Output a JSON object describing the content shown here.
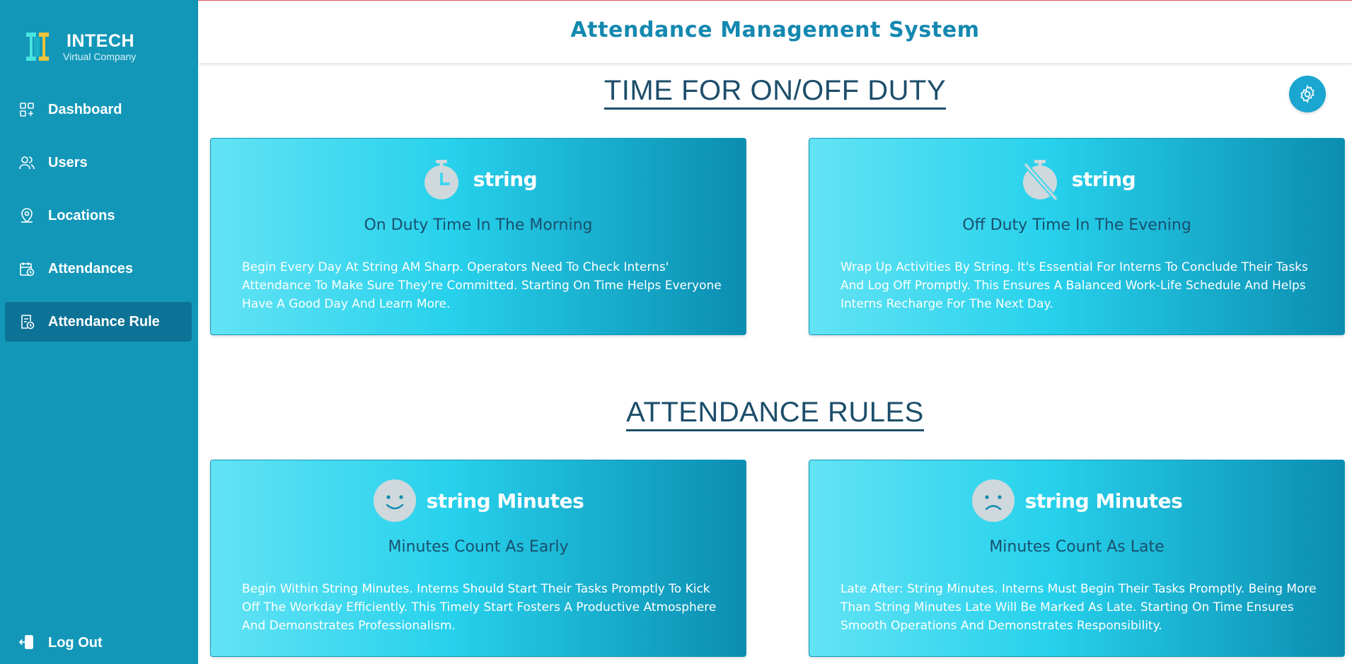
{
  "brand": {
    "name": "INTECH",
    "tagline": "Virtual Company"
  },
  "sidebar": {
    "items": [
      {
        "label": "Dashboard",
        "icon": "dashboard-icon"
      },
      {
        "label": "Users",
        "icon": "users-icon"
      },
      {
        "label": "Locations",
        "icon": "location-icon"
      },
      {
        "label": "Attendances",
        "icon": "calendar-clock-icon"
      },
      {
        "label": "Attendance Rule",
        "icon": "rule-icon",
        "active": true
      }
    ],
    "logout": {
      "label": "Log Out",
      "icon": "logout-icon"
    }
  },
  "header": {
    "title": "Attendance Management System"
  },
  "sections": {
    "duty_title": "TIME FOR ON/OFF DUTY",
    "rules_title": "ATTENDANCE RULES"
  },
  "settings": {
    "icon": "settings-gear-icon"
  },
  "cards": {
    "on_duty": {
      "icon": "stopwatch-icon",
      "value": "string",
      "subtitle": "On Duty Time In The Morning",
      "description": "Begin Every Day At String AM Sharp. Operators Need To Check Interns' Attendance To Make Sure They're Committed. Starting On Time Helps Everyone Have A Good Day And Learn More."
    },
    "off_duty": {
      "icon": "stopwatch-off-icon",
      "value": "string",
      "subtitle": "Off Duty Time In The Evening",
      "description": "Wrap Up Activities By String. It's Essential For Interns To Conclude Their Tasks And Log Off Promptly. This Ensures A Balanced Work-Life Schedule And Helps Interns Recharge For The Next Day."
    },
    "early": {
      "icon": "smile-face-icon",
      "value": "string Minutes",
      "subtitle": "Minutes Count As Early",
      "description": "Begin Within String Minutes. Interns Should Start Their Tasks Promptly To Kick Off The Workday Efficiently. This Timely Start Fosters A Productive Atmosphere And Demonstrates Professionalism."
    },
    "late": {
      "icon": "sad-face-icon",
      "value": "string Minutes",
      "subtitle": "Minutes Count As Late",
      "description": "Late After: String Minutes. Interns Must Begin Their Tasks Promptly. Being More Than String Minutes Late Will Be Marked As Late. Starting On Time Ensures Smooth Operations And Demonstrates Responsibility."
    }
  },
  "colors": {
    "sidebar": "#1397b8",
    "sidebar_active": "#0d7396",
    "header_title": "#1488b0",
    "section_title": "#1d4e6b",
    "card_gradient_start": "#62e3f4",
    "card_gradient_end": "#0b8db1",
    "icon_badge": "#cfd8dc"
  }
}
